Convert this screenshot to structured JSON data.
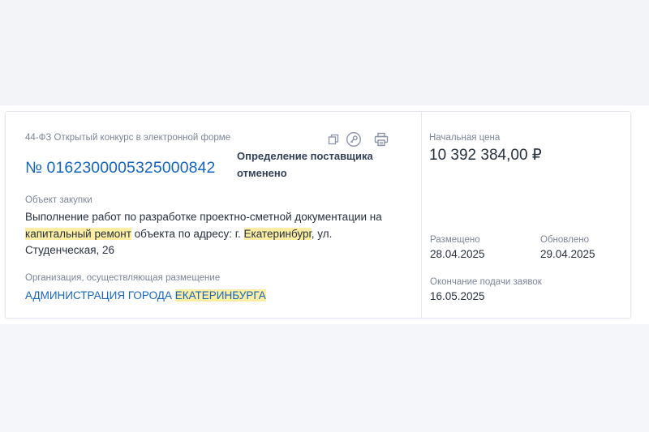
{
  "procurement": {
    "type": "44-ФЗ Открытый конкурс в электронной форме",
    "number": "№ 0162300005325000842",
    "status": "Определение поставщика отменено",
    "object_label": "Объект закупки",
    "object_parts": [
      "Выполнение работ по разработке проектно-сметной документации на ",
      "капитальный ремонт",
      " объекта по адресу: г. ",
      "Екатеринбург",
      ", ул. Студенческая, 26"
    ],
    "org_label": "Организация, осуществляющая размещение",
    "org_parts": [
      "АДМИНИСТРАЦИЯ ГОРОДА ",
      "ЕКАТЕРИНБУРГА"
    ]
  },
  "actions": {
    "icons": [
      "copy-icon",
      "key-icon",
      "print-icon"
    ],
    "icon_color": "#8a93a6"
  },
  "pricing": {
    "price_label": "Начальная цена",
    "price_value": "10 392 384,00 ₽"
  },
  "dates": {
    "posted_label": "Размещено",
    "posted_value": "28.04.2025",
    "updated_label": "Обновлено",
    "updated_value": "29.04.2025",
    "deadline_label": "Окончание подачи заявок",
    "deadline_value": "16.05.2025"
  },
  "colors": {
    "accent": "#1565c0",
    "highlight": "#fdeea3",
    "muted_text": "#7b8596",
    "main_text": "#27303f"
  }
}
